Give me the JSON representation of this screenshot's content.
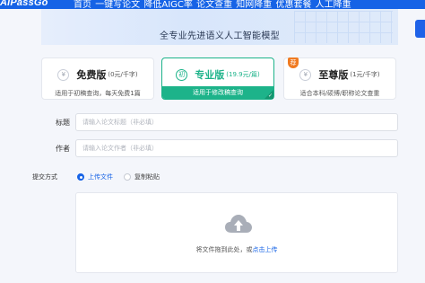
{
  "header": {
    "logo": "AiPassGo",
    "nav": [
      "首页",
      "一键写论文",
      "降低AIGC率",
      "论文查重",
      "知网降重",
      "优惠套餐",
      "人工降重"
    ]
  },
  "banner": {
    "title": "全专业先进语义人工智能模型"
  },
  "plans": [
    {
      "name": "免费版",
      "price": "(0元/千字)",
      "desc": "适用于初稿查询，每天免费1篇",
      "selected": false,
      "icon": "free-icon",
      "icon_glyph": "¥"
    },
    {
      "name": "专业版",
      "price": "(19.9元/篇)",
      "desc": "适用于修改稿查询",
      "selected": true,
      "icon": "pro-icon",
      "icon_glyph": "初"
    },
    {
      "name": "至尊版",
      "price": "(1元/千字)",
      "desc": "适合本科/硕博/职称论文查重",
      "selected": false,
      "icon": "premium-icon",
      "icon_glyph": "¥",
      "badge": "荐"
    }
  ],
  "form": {
    "title_label": "标题",
    "title_placeholder": "请输入论文标题（非必填）",
    "author_label": "作者",
    "author_placeholder": "请输入论文作者（非必填）",
    "submit_method_label": "提交方式",
    "options": [
      {
        "label": "上传文件",
        "selected": true
      },
      {
        "label": "复制粘贴",
        "selected": false
      }
    ]
  },
  "upload": {
    "text_prefix": "将文件拖到此处，或",
    "link_text": "点击上传"
  },
  "colors": {
    "primary": "#1663e6",
    "accent_green": "#1db38a",
    "badge_orange": "#f07a20"
  }
}
